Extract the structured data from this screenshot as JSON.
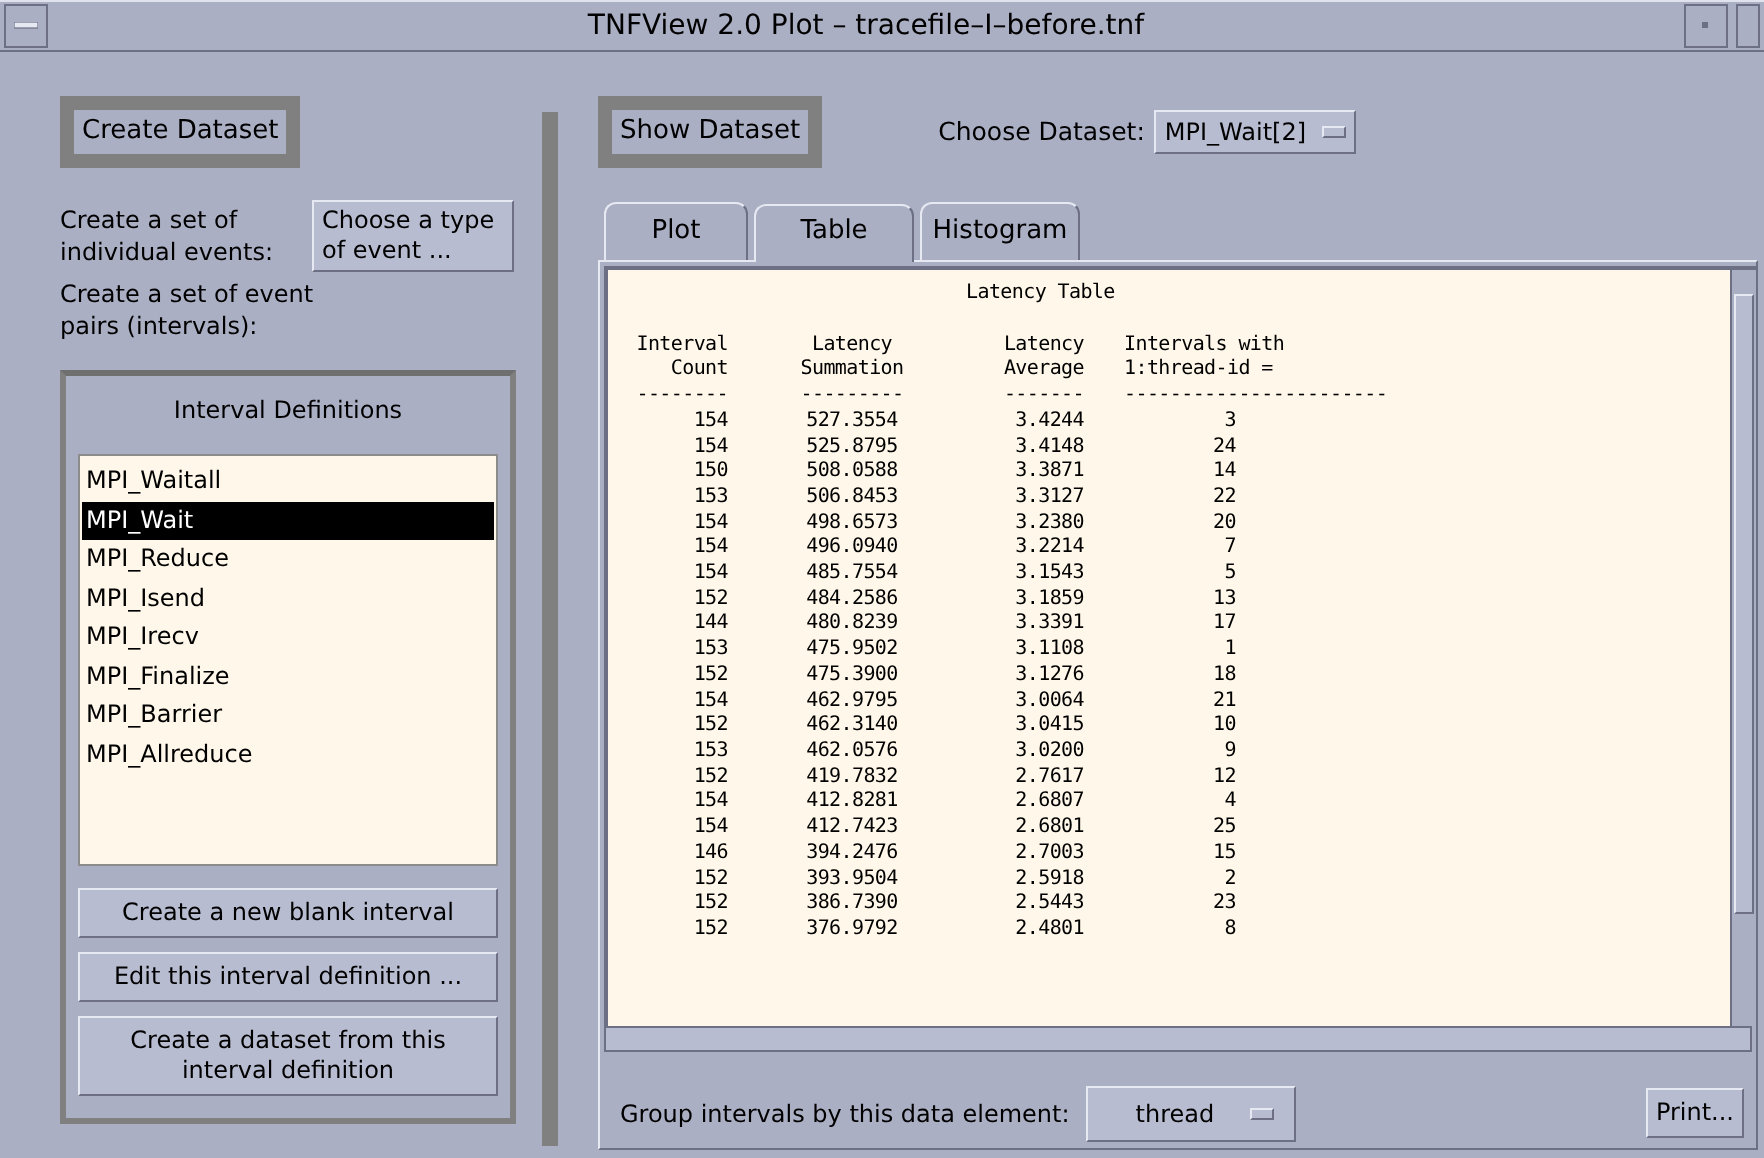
{
  "window": {
    "title": "TNFView 2.0 Plot – tracefile–I–before.tnf"
  },
  "left": {
    "create_dataset_button": "Create Dataset",
    "individual_label": "Create a set of individual events:",
    "event_type_button": "Choose a type of event ...",
    "pairs_label": "Create a set of event pairs (intervals):",
    "group_title": "Interval Definitions",
    "intervals": [
      {
        "label": "MPI_Waitall",
        "selected": false
      },
      {
        "label": "MPI_Wait",
        "selected": true
      },
      {
        "label": "MPI_Reduce",
        "selected": false
      },
      {
        "label": "MPI_Isend",
        "selected": false
      },
      {
        "label": "MPI_Irecv",
        "selected": false
      },
      {
        "label": "MPI_Finalize",
        "selected": false
      },
      {
        "label": "MPI_Barrier",
        "selected": false
      },
      {
        "label": "MPI_Allreduce",
        "selected": false
      }
    ],
    "buttons": [
      "Create a new blank interval",
      "Edit this interval definition ...",
      "Create a dataset from this interval definition"
    ]
  },
  "right": {
    "show_dataset_button": "Show Dataset",
    "choose_label": "Choose Dataset:",
    "dataset_value": "MPI_Wait[2]",
    "tabs": [
      {
        "label": "Plot",
        "selected": false
      },
      {
        "label": "Table",
        "selected": true
      },
      {
        "label": "Histogram",
        "selected": false
      }
    ],
    "table": {
      "title": "Latency Table",
      "columns": [
        {
          "lines": [
            "Interval",
            "Count"
          ],
          "rule": "--------"
        },
        {
          "lines": [
            "Latency",
            "Summation"
          ],
          "rule": "---------"
        },
        {
          "lines": [
            "Latency",
            "Average"
          ],
          "rule": "-------"
        },
        {
          "lines": [
            "Intervals with",
            "1:thread-id ="
          ],
          "rule": "-----------------------"
        }
      ],
      "rows": [
        [
          "154",
          "527.3554",
          "3.4244",
          "3"
        ],
        [
          "154",
          "525.8795",
          "3.4148",
          "24"
        ],
        [
          "150",
          "508.0588",
          "3.3871",
          "14"
        ],
        [
          "153",
          "506.8453",
          "3.3127",
          "22"
        ],
        [
          "154",
          "498.6573",
          "3.2380",
          "20"
        ],
        [
          "154",
          "496.0940",
          "3.2214",
          "7"
        ],
        [
          "154",
          "485.7554",
          "3.1543",
          "5"
        ],
        [
          "152",
          "484.2586",
          "3.1859",
          "13"
        ],
        [
          "144",
          "480.8239",
          "3.3391",
          "17"
        ],
        [
          "153",
          "475.9502",
          "3.1108",
          "1"
        ],
        [
          "152",
          "475.3900",
          "3.1276",
          "18"
        ],
        [
          "154",
          "462.9795",
          "3.0064",
          "21"
        ],
        [
          "152",
          "462.3140",
          "3.0415",
          "10"
        ],
        [
          "153",
          "462.0576",
          "3.0200",
          "9"
        ],
        [
          "152",
          "419.7832",
          "2.7617",
          "12"
        ],
        [
          "154",
          "412.8281",
          "2.6807",
          "4"
        ],
        [
          "154",
          "412.7423",
          "2.6801",
          "25"
        ],
        [
          "146",
          "394.2476",
          "2.7003",
          "15"
        ],
        [
          "152",
          "393.9504",
          "2.5918",
          "2"
        ],
        [
          "152",
          "386.7390",
          "2.5443",
          "23"
        ],
        [
          "152",
          "376.9792",
          "2.4801",
          "8"
        ]
      ]
    },
    "group_label": "Group intervals by this data element:",
    "group_value": "thread",
    "print_button": "Print..."
  }
}
